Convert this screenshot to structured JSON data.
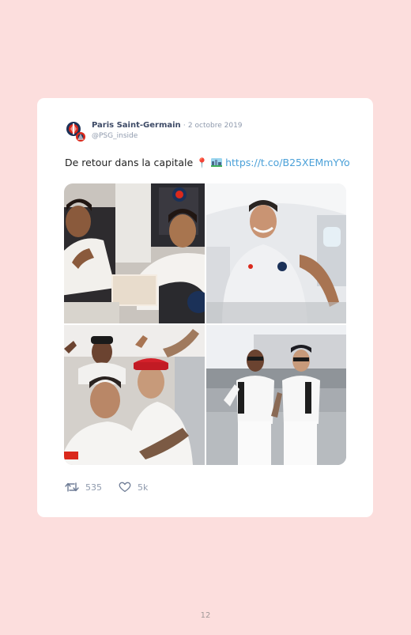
{
  "tweet": {
    "display_name": "Paris Saint-Germain",
    "separator": "·",
    "date": "2 octobre 2019",
    "handle": "@PSG_inside",
    "text": "De retour dans la capitale",
    "pin_emoji": "📍",
    "link": "https://t.co/B25XEMmYYo",
    "retweets": "535",
    "likes": "5k"
  },
  "icons": {
    "avatar": "psg-logo-avatar",
    "pin": "round-pushpin-icon",
    "place": "cityscape-emoji-icon",
    "retweet": "retweet-icon",
    "like": "heart-icon"
  },
  "colors": {
    "page_background": "#fcdedd",
    "card_background": "#ffffff",
    "name": "#3d4a66",
    "meta": "#8f9aad",
    "link": "#4aa0d8",
    "psg_blue": "#1b3158",
    "psg_red": "#da291c"
  },
  "page": {
    "number": "12"
  }
}
